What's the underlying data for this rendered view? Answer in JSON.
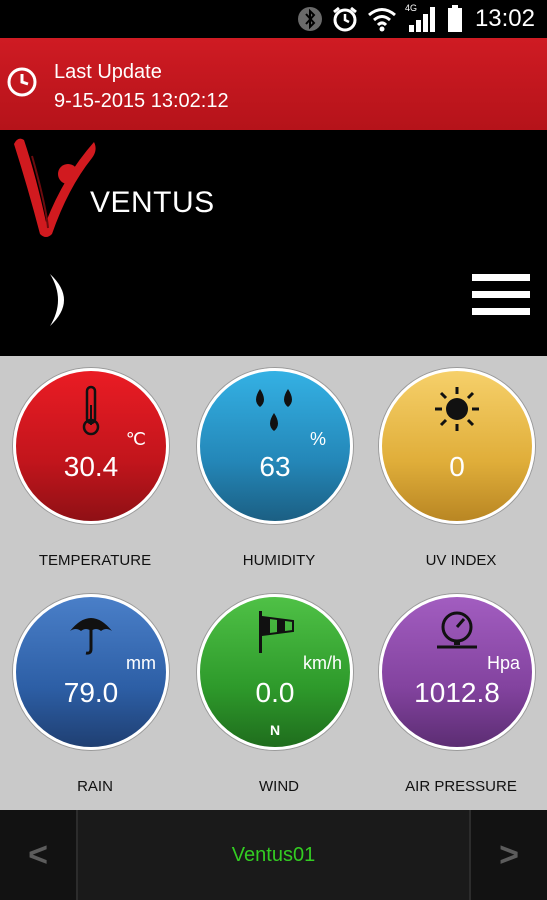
{
  "status_bar": {
    "time": "13:02",
    "network_badge": "4G",
    "icons": [
      "bluetooth-icon",
      "alarm-icon",
      "wifi-icon",
      "signal-icon",
      "battery-icon"
    ]
  },
  "update": {
    "label": "Last Update",
    "timestamp": "9-15-2015 13:02:12"
  },
  "brand": {
    "name": "VENTUS"
  },
  "tiles": [
    {
      "id": "temperature",
      "label": "TEMPERATURE",
      "value": "30.4",
      "unit": "℃",
      "icon": "thermometer-icon",
      "color": "#d81920"
    },
    {
      "id": "humidity",
      "label": "HUMIDITY",
      "value": "63",
      "unit": "%",
      "icon": "water-drops-icon",
      "color": "#2a9bd0"
    },
    {
      "id": "uv",
      "label": "UV INDEX",
      "value": "0",
      "unit": "",
      "icon": "sun-icon",
      "color": "#e8b84a"
    },
    {
      "id": "rain",
      "label": "RAIN",
      "value": "79.0",
      "unit": "mm",
      "icon": "umbrella-icon",
      "color": "#2f63aa"
    },
    {
      "id": "wind",
      "label": "WIND",
      "value": "0.0",
      "unit": "km/h",
      "direction": "N",
      "icon": "windsock-icon",
      "color": "#33a22f"
    },
    {
      "id": "air_pressure",
      "label": "AIR PRESSURE",
      "value": "1012.8",
      "unit": "Hpa",
      "icon": "gauge-icon",
      "color": "#8c48a8"
    }
  ],
  "nav": {
    "prev": "<",
    "next": ">",
    "station": "Ventus01"
  }
}
